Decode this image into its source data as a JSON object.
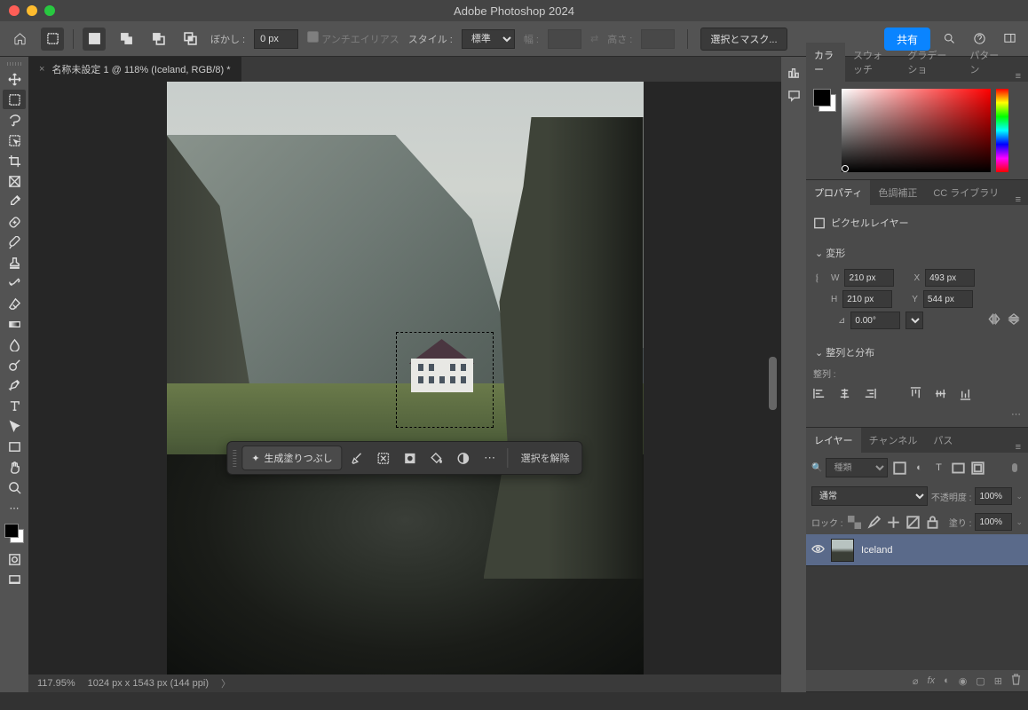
{
  "title": "Adobe Photoshop 2024",
  "options": {
    "feather_label": "ぼかし :",
    "feather_value": "0 px",
    "antialias": "アンチエイリアス",
    "style_label": "スタイル :",
    "style_value": "標準",
    "width_label": "幅 :",
    "height_label": "高さ :",
    "select_mask": "選択とマスク...",
    "share": "共有"
  },
  "tab": {
    "title": "名称未設定 1 @ 118% (Iceland, RGB/8) *"
  },
  "context_bar": {
    "gen_fill": "生成塗りつぶし",
    "deselect": "選択を解除"
  },
  "status": {
    "zoom": "117.95%",
    "dims": "1024 px x 1543 px (144 ppi)"
  },
  "panels": {
    "color": {
      "tab1": "カラー",
      "tab2": "スウォッチ",
      "tab3": "グラデーショ",
      "tab4": "パターン"
    },
    "props": {
      "tab1": "プロパティ",
      "tab2": "色調補正",
      "tab3": "CC ライブラリ",
      "type": "ピクセルレイヤー",
      "transform": "変形",
      "w_label": "W",
      "w_value": "210 px",
      "h_label": "H",
      "h_value": "210 px",
      "x_label": "X",
      "x_value": "493 px",
      "y_label": "Y",
      "y_value": "544 px",
      "angle": "0.00°",
      "align": "整列と分布",
      "align_label": "整列 :"
    },
    "layers": {
      "tab1": "レイヤー",
      "tab2": "チャンネル",
      "tab3": "パス",
      "filter": "種類",
      "blend": "通常",
      "opacity_label": "不透明度 :",
      "opacity": "100%",
      "lock_label": "ロック :",
      "fill_label": "塗り :",
      "fill": "100%",
      "layer_name": "Iceland"
    }
  }
}
